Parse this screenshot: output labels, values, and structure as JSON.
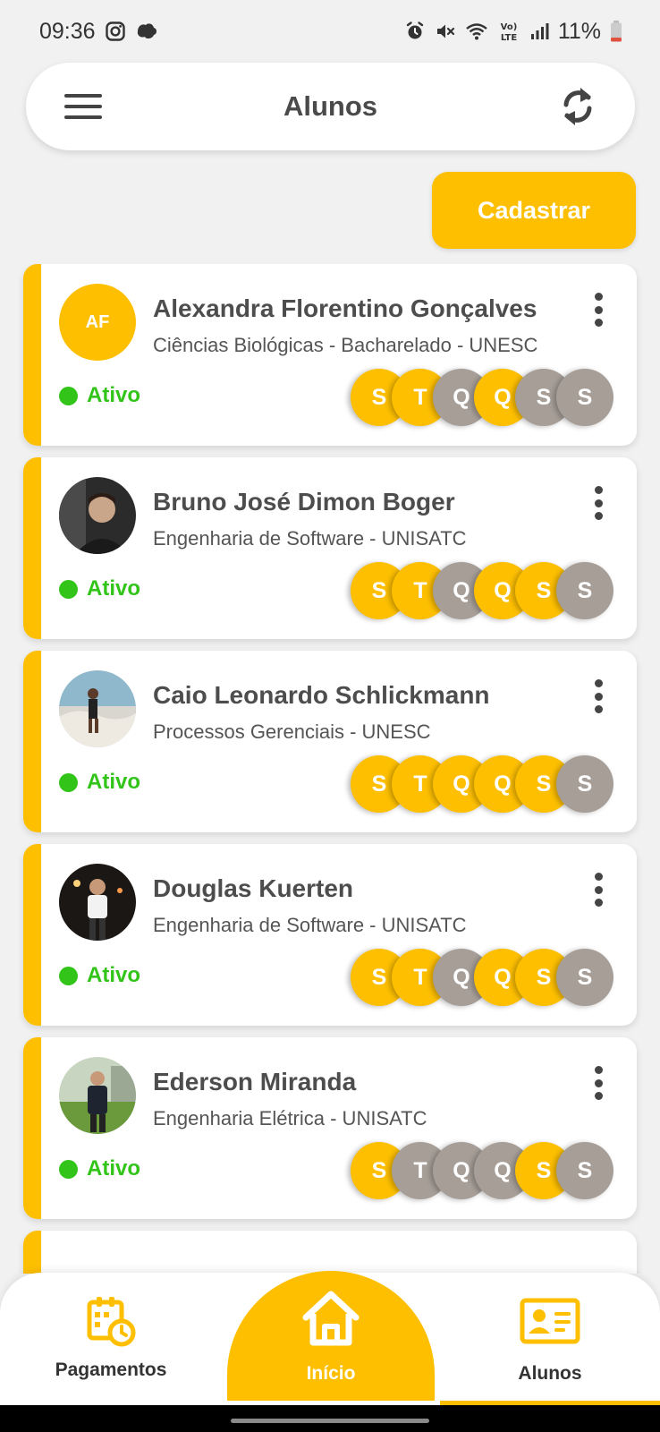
{
  "status_bar": {
    "time": "09:36",
    "battery": "11%",
    "left_icons": [
      "instagram-icon",
      "notification-icon"
    ],
    "right_icons": [
      "alarm-icon",
      "mute-icon",
      "wifi-icon",
      "volte-icon",
      "signal-icon",
      "battery-icon"
    ]
  },
  "header": {
    "title": "Alunos",
    "menu_icon": "hamburger-menu-icon",
    "refresh_icon": "refresh-icon"
  },
  "register_button": {
    "label": "Cadastrar"
  },
  "colors": {
    "accent": "#fdbf00",
    "active_green": "#33c41a",
    "day_off": "#a69e97",
    "background": "#f1f1f1"
  },
  "students": [
    {
      "name": "Alexandra Florentino Gonçalves",
      "course": "Ciências Biológicas - Bacharelado - UNESC",
      "initials": "AF",
      "avatar": "initials",
      "status": "Ativo",
      "days": [
        {
          "label": "S",
          "active": true
        },
        {
          "label": "T",
          "active": true
        },
        {
          "label": "Q",
          "active": false
        },
        {
          "label": "Q",
          "active": true
        },
        {
          "label": "S",
          "active": false
        },
        {
          "label": "S",
          "active": false
        }
      ]
    },
    {
      "name": "Bruno José Dimon Boger",
      "course": "Engenharia de Software - UNISATC",
      "initials": "",
      "avatar": "photo",
      "status": "Ativo",
      "days": [
        {
          "label": "S",
          "active": true
        },
        {
          "label": "T",
          "active": true
        },
        {
          "label": "Q",
          "active": false
        },
        {
          "label": "Q",
          "active": true
        },
        {
          "label": "S",
          "active": true
        },
        {
          "label": "S",
          "active": false
        }
      ]
    },
    {
      "name": "Caio Leonardo Schlickmann",
      "course": "Processos Gerenciais - UNESC",
      "initials": "",
      "avatar": "photo",
      "status": "Ativo",
      "days": [
        {
          "label": "S",
          "active": true
        },
        {
          "label": "T",
          "active": true
        },
        {
          "label": "Q",
          "active": true
        },
        {
          "label": "Q",
          "active": true
        },
        {
          "label": "S",
          "active": true
        },
        {
          "label": "S",
          "active": false
        }
      ]
    },
    {
      "name": "Douglas Kuerten",
      "course": "Engenharia de Software - UNISATC",
      "initials": "",
      "avatar": "photo",
      "status": "Ativo",
      "days": [
        {
          "label": "S",
          "active": true
        },
        {
          "label": "T",
          "active": true
        },
        {
          "label": "Q",
          "active": false
        },
        {
          "label": "Q",
          "active": true
        },
        {
          "label": "S",
          "active": true
        },
        {
          "label": "S",
          "active": false
        }
      ]
    },
    {
      "name": "Ederson Miranda",
      "course": "Engenharia Elétrica - UNISATC",
      "initials": "",
      "avatar": "photo",
      "status": "Ativo",
      "days": [
        {
          "label": "S",
          "active": true
        },
        {
          "label": "T",
          "active": false
        },
        {
          "label": "Q",
          "active": false
        },
        {
          "label": "Q",
          "active": false
        },
        {
          "label": "S",
          "active": true
        },
        {
          "label": "S",
          "active": false
        }
      ]
    }
  ],
  "bottom_nav": {
    "items": [
      {
        "label": "Pagamentos",
        "icon": "payment-calendar-icon",
        "active": false
      },
      {
        "label": "Início",
        "icon": "home-icon",
        "active": false
      },
      {
        "label": "Alunos",
        "icon": "student-card-icon",
        "active": true
      }
    ]
  }
}
